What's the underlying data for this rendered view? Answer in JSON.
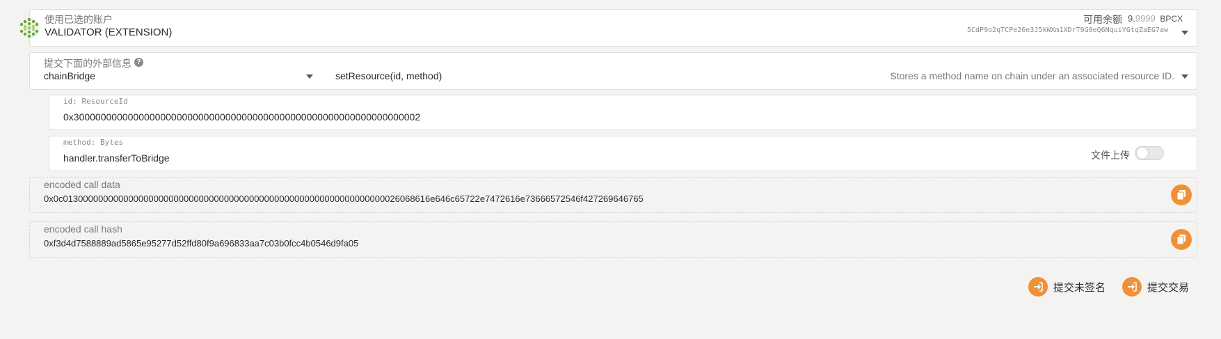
{
  "account": {
    "label": "使用已选的账户",
    "name": "VALIDATOR (EXTENSION)",
    "balance_label": "可用余额",
    "balance_int": "9.",
    "balance_frac": "9999",
    "balance_unit": "BPCX",
    "address": "5CdP9o2qTCPe26e3J5kWXm1XDrT9G9eQ6NquiYGtqZaEG7aw"
  },
  "extrinsic": {
    "label": "提交下面的外部信息",
    "help_icon": "question-circle-icon",
    "module": "chainBridge",
    "method": "setResource(id, method)",
    "method_description": "Stores a method name on chain under an associated resource ID."
  },
  "params": [
    {
      "label": "id: ResourceId",
      "value": "0x3000000000000000000000000000000000000000000000000000000000000002"
    },
    {
      "label": "method: Bytes",
      "value": "handler.transferToBridge",
      "file_upload_label": "文件上传"
    }
  ],
  "encoded": {
    "call_data_label": "encoded call data",
    "call_data": "0x0c0130000000000000000000000000000000000000000000000000000000000000026068616e646c65722e7472616e73666572546f427269646765",
    "call_hash_label": "encoded call hash",
    "call_hash": "0xf3d4d7588889ad5865e95277d52ffd80f9a696833aa7c03b0fcc4b0546d9fa05"
  },
  "actions": {
    "unsigned_label": "提交未签名",
    "submit_label": "提交交易"
  },
  "colors": {
    "accent": "#f19135",
    "background": "#f4f3f1"
  }
}
